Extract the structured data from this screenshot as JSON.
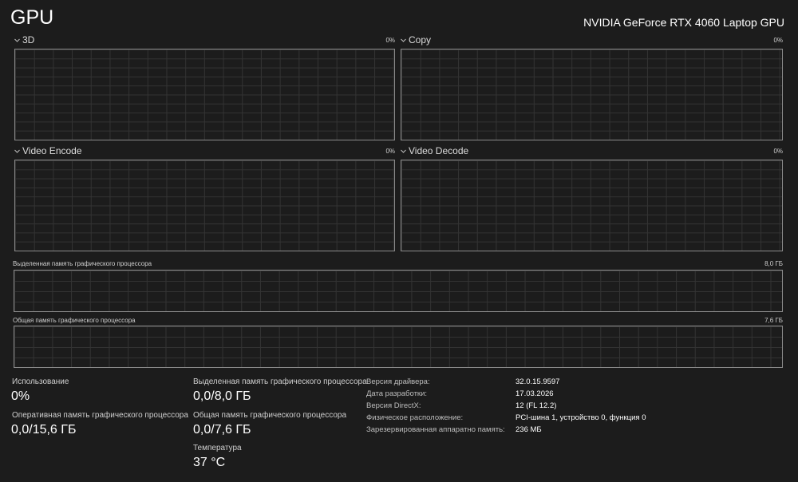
{
  "header": {
    "title": "GPU",
    "gpu_name": "NVIDIA GeForce RTX 4060 Laptop GPU"
  },
  "engines": [
    {
      "label": "3D",
      "percent": "0%"
    },
    {
      "label": "Copy",
      "percent": "0%"
    },
    {
      "label": "Video Encode",
      "percent": "0%"
    },
    {
      "label": "Video Decode",
      "percent": "0%"
    }
  ],
  "memory_graphs": {
    "dedicated": {
      "label": "Выделенная память графического процессора",
      "max": "8,0 ГБ"
    },
    "shared": {
      "label": "Общая память графического процессора",
      "max": "7,6 ГБ"
    }
  },
  "stats": {
    "utilization": {
      "label": "Использование",
      "value": "0%"
    },
    "gpu_ram": {
      "label": "Оперативная память графического процессора",
      "value": "0,0/15,6 ГБ"
    },
    "dedicated_mem": {
      "label": "Выделенная память графического процессора",
      "value": "0,0/8,0 ГБ"
    },
    "shared_mem": {
      "label": "Общая память графического процессора",
      "value": "0,0/7,6 ГБ"
    },
    "temperature": {
      "label": "Температура",
      "value": "37 °C"
    }
  },
  "info": [
    {
      "key": "Версия драйвера:",
      "value": "32.0.15.9597"
    },
    {
      "key": "Дата разработки:",
      "value": "17.03.2026"
    },
    {
      "key": "Версия DirectX:",
      "value": "12 (FL 12.2)"
    },
    {
      "key": "Физическое расположение:",
      "value": "PCI-шина 1, устройство 0, функция 0"
    },
    {
      "key": "Зарезервированная аппаратно память:",
      "value": "236 МБ"
    }
  ],
  "icons": {
    "engine_selector": "chevron-down-icon"
  }
}
